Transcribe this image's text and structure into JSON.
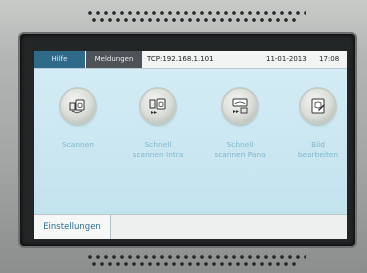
{
  "header": {
    "help_tab": "Hilfe",
    "messages_tab": "Meldungen",
    "connection": "TCP:192.168.1.101",
    "date": "11-01-2013",
    "time": "17:08"
  },
  "actions": [
    {
      "label_line1": "Scannen",
      "label_line2": "",
      "icon": "scan-icon"
    },
    {
      "label_line1": "Schnell",
      "label_line2": "scannen Intra",
      "icon": "quick-scan-intra-icon"
    },
    {
      "label_line1": "Schnell",
      "label_line2": "scannen Pano",
      "icon": "quick-scan-pano-icon"
    },
    {
      "label_line1": "Bild",
      "label_line2": "bearbeiten",
      "icon": "edit-image-icon"
    }
  ],
  "footer": {
    "settings_button": "Einstellungen"
  },
  "colors": {
    "accent_tab": "#2f6a8a",
    "secondary_tab": "#4d5356",
    "screen_background": "#cfe9f2",
    "action_label": "#7eb7cf",
    "settings_text": "#2a6f8f"
  }
}
